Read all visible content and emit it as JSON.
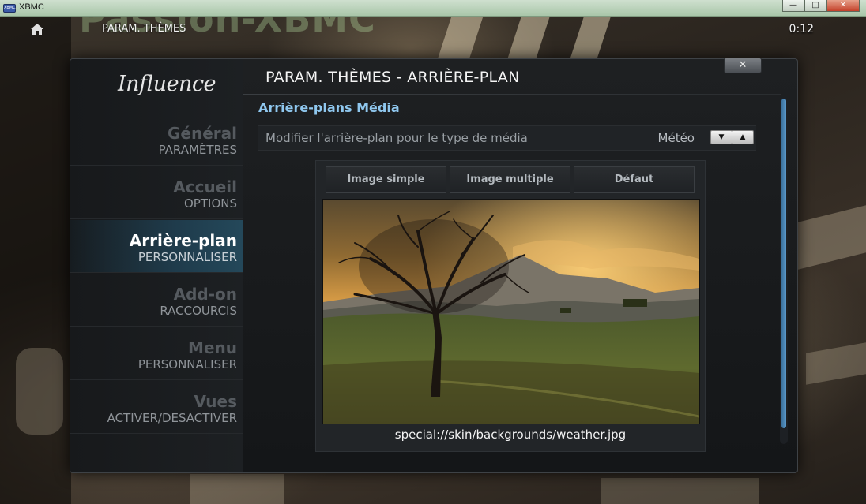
{
  "window": {
    "title": "XBMC",
    "icon_label": "XBMC",
    "buttons": {
      "minimize": "—",
      "maximize": "□",
      "close": "✕"
    }
  },
  "background_text": "Passion-XBMC",
  "header": {
    "home_icon": "home-icon",
    "title": "PARAM. THÈMES",
    "clock": "0:12"
  },
  "dialog": {
    "close_label": "✕",
    "logo": "Influence",
    "title": "PARAM. THÈMES - ARRIÈRE-PLAN",
    "section_heading": "Arrière-plans Média",
    "setting": {
      "label": "Modifier l'arrière-plan pour le type de média",
      "value": "Météo",
      "down_arrow": "▼",
      "up_arrow": "▲"
    },
    "tabs": [
      "Image simple",
      "Image multiple",
      "Défaut"
    ],
    "image_path": "special://skin/backgrounds/weather.jpg",
    "scrollbar_position": 0.0
  },
  "sidebar": {
    "items": [
      {
        "title": "Général",
        "subtitle": "PARAMÈTRES",
        "active": false
      },
      {
        "title": "Accueil",
        "subtitle": "OPTIONS",
        "active": false
      },
      {
        "title": "Arrière-plan",
        "subtitle": "PERSONNALISER",
        "active": true
      },
      {
        "title": "Add-on",
        "subtitle": "RACCOURCIS",
        "active": false
      },
      {
        "title": "Menu",
        "subtitle": "PERSONNALISER",
        "active": false
      },
      {
        "title": "Vues",
        "subtitle": "ACTIVER/DESACTIVER",
        "active": false
      }
    ]
  },
  "colors": {
    "accent": "#8fc7ee",
    "active_item": "#1f3b4b",
    "scrollbar": "#5b9acb"
  }
}
